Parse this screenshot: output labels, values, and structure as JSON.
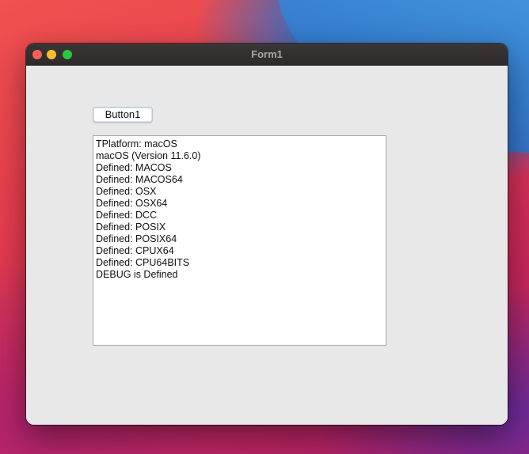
{
  "window": {
    "title": "Form1"
  },
  "button1": {
    "label": "Button1"
  },
  "memo": {
    "lines": [
      "TPlatform: macOS",
      "macOS (Version 11.6.0)",
      "Defined: MACOS",
      "Defined: MACOS64",
      "Defined: OSX",
      "Defined: OSX64",
      "Defined: DCC",
      "Defined: POSIX",
      "Defined: POSIX64",
      "Defined: CPUX64",
      "Defined: CPU64BITS",
      "DEBUG is Defined"
    ]
  },
  "colors": {
    "close": "#fe5f57",
    "minimize": "#febc2e",
    "maximize": "#28c840"
  }
}
